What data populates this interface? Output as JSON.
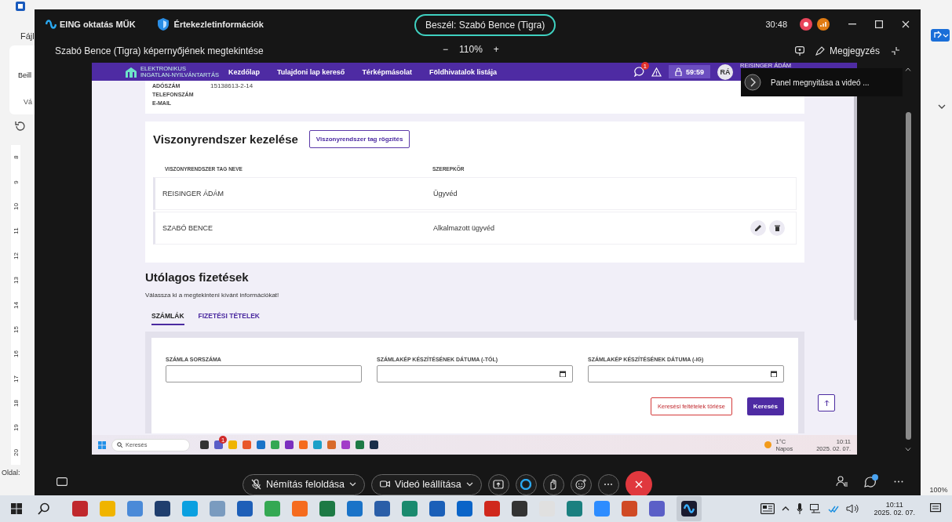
{
  "word": {
    "menu_tab": "Fájl",
    "ribbon_label": "Beill",
    "group_label": "Vá",
    "ruler_marks": [
      "8",
      "9",
      "10",
      "11",
      "12",
      "13",
      "14",
      "15",
      "16",
      "17",
      "18",
      "19",
      "20"
    ],
    "status_left": "Oldal:",
    "zoom": "100%"
  },
  "meeting": {
    "title": "EING oktatás MŰK",
    "info": "Értekezletinformációk",
    "speaker": "Beszél: Szabó Bence (Tigra)",
    "timer": "30:48",
    "share_title": "Szabó Bence (Tigra) képernyőjének megtekintése",
    "zoom_out": "−",
    "zoom": "110%",
    "zoom_in": "+",
    "notes": "Megjegyzés",
    "panel_tip": "Panel megnyitása a videó ...",
    "controls": [
      {
        "label": "Némítás feloldása",
        "kind": "mute"
      },
      {
        "label": "Videó leállítása",
        "kind": "video"
      }
    ]
  },
  "shared_app": {
    "brand": [
      "ELEKTRONIKUS",
      "INGATLAN-NYILVÁNTARTÁS"
    ],
    "nav": [
      {
        "label": "Kezdőlap"
      },
      {
        "label": "Tulajdoni lap kereső"
      },
      {
        "label": "Térképmásolat"
      },
      {
        "label": "Földhivatalok listája"
      }
    ],
    "notification_count": "1",
    "session_time": "59:59",
    "user_initials": "RÁ",
    "user_name": "REISINGER ÁDÁM",
    "profile": [
      {
        "label": "ADÓSZÁM",
        "value": "15138613-2-14"
      },
      {
        "label": "TELEFONSZÁM"
      },
      {
        "label": "E-MAIL"
      }
    ],
    "relations": {
      "title": "Viszonyrendszer kezelése",
      "add_button": "Viszonyrendszer tag rögzítés",
      "columns": [
        "VISZONYRENDSZER TAG NEVE",
        "SZEREPKÖR"
      ],
      "rows": [
        {
          "name": "REISINGER ÁDÁM",
          "role": "Ügyvéd",
          "actions": false
        },
        {
          "name": "SZABÓ BENCE",
          "role": "Alkalmazott ügyvéd",
          "actions": true
        }
      ]
    },
    "payments": {
      "title": "Utólagos fizetések",
      "hint": "Válassza ki a megtekinteni kívánt információkat!",
      "tabs": [
        {
          "label": "SZÁMLÁK",
          "selected": true
        },
        {
          "label": "FIZETÉSI TÉTELEK",
          "selected": false
        }
      ],
      "fields": [
        {
          "label": "SZÁMLA SORSZÁMA",
          "kind": "text"
        },
        {
          "label": "SZÁMLAKÉP KÉSZÍTÉSÉNEK DÁTUMA (-TÓL)",
          "kind": "date"
        },
        {
          "label": "SZÁMLAKÉP KÉSZÍTÉSÉNEK DÁTUMA (-IG)",
          "kind": "date"
        }
      ],
      "clear_button": "Keresési feltételek törlése",
      "search_button": "Keresés"
    }
  },
  "guest_taskbar": {
    "search_placeholder": "Keresés",
    "badge": "1",
    "weather_temp": "1°C",
    "weather_text": "Napos",
    "time": "10:11",
    "date": "2025. 02. 07."
  },
  "taskbar": {
    "time": "10:11",
    "date": "2025. 02. 07."
  }
}
